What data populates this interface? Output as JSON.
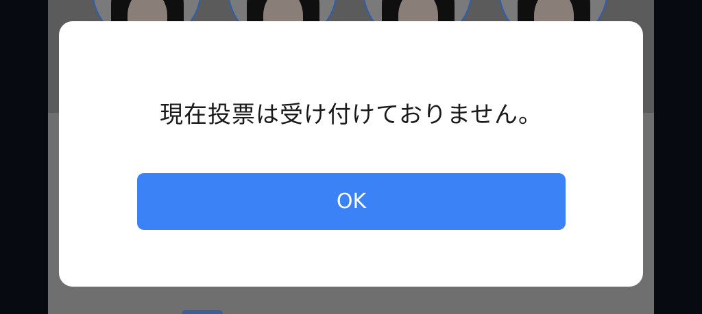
{
  "dialog": {
    "message": "現在投票は受け付けておりません。",
    "ok_label": "OK"
  },
  "background": {
    "avatars": [
      {
        "name": "candidate-avatar-1"
      },
      {
        "name": "candidate-avatar-2"
      },
      {
        "name": "candidate-avatar-3"
      },
      {
        "name": "candidate-avatar-4"
      }
    ]
  },
  "colors": {
    "accent": "#3b82f6",
    "dialog_bg": "#ffffff",
    "dim_bg": "#6f6f6f",
    "avatar_border": "#2d5fb0"
  }
}
